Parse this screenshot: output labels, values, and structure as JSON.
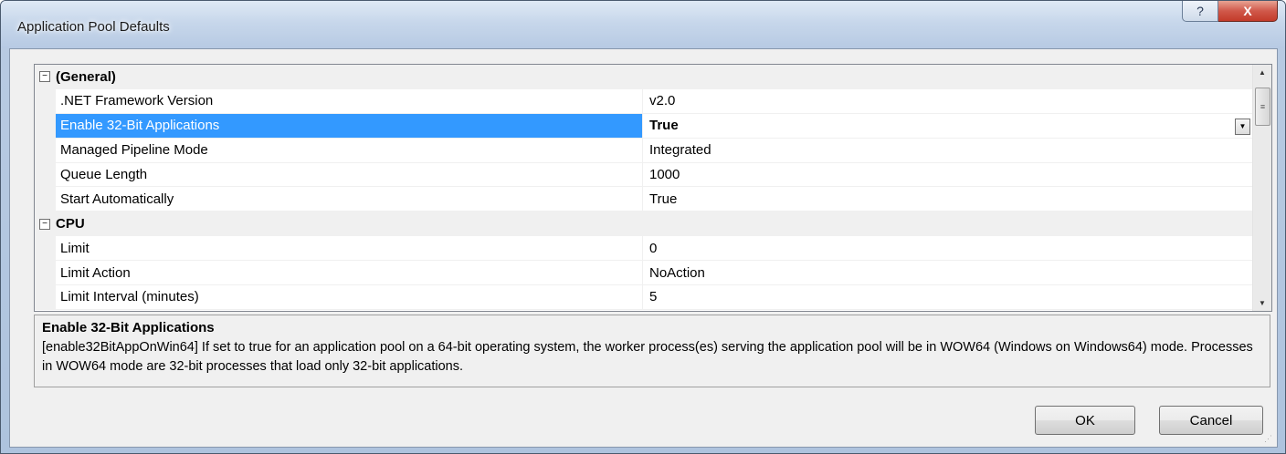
{
  "window": {
    "title": "Application Pool Defaults",
    "help_glyph": "?",
    "close_glyph": "X"
  },
  "grid": {
    "categories": [
      {
        "label": "(General)",
        "toggle": "⊟",
        "properties": [
          {
            "name": ".NET Framework Version",
            "value": "v2.0"
          },
          {
            "name": "Enable 32-Bit Applications",
            "value": "True",
            "selected": true
          },
          {
            "name": "Managed Pipeline Mode",
            "value": "Integrated"
          },
          {
            "name": "Queue Length",
            "value": "1000"
          },
          {
            "name": "Start Automatically",
            "value": "True"
          }
        ]
      },
      {
        "label": "CPU",
        "toggle": "⊟",
        "properties": [
          {
            "name": "Limit",
            "value": "0"
          },
          {
            "name": "Limit Action",
            "value": "NoAction"
          },
          {
            "name": "Limit Interval (minutes)",
            "value": "5"
          }
        ]
      }
    ]
  },
  "description": {
    "title": "Enable 32-Bit Applications",
    "text": "[enable32BitAppOnWin64] If set to true for an application pool on a 64-bit operating system, the worker process(es) serving the application pool will be in WOW64 (Windows on Windows64) mode. Processes in WOW64 mode are 32-bit processes that load only 32-bit applications."
  },
  "buttons": {
    "ok": "OK",
    "cancel": "Cancel"
  },
  "icons": {
    "help": "help-icon",
    "close": "close-icon",
    "dropdown": "chevron-down-icon"
  }
}
